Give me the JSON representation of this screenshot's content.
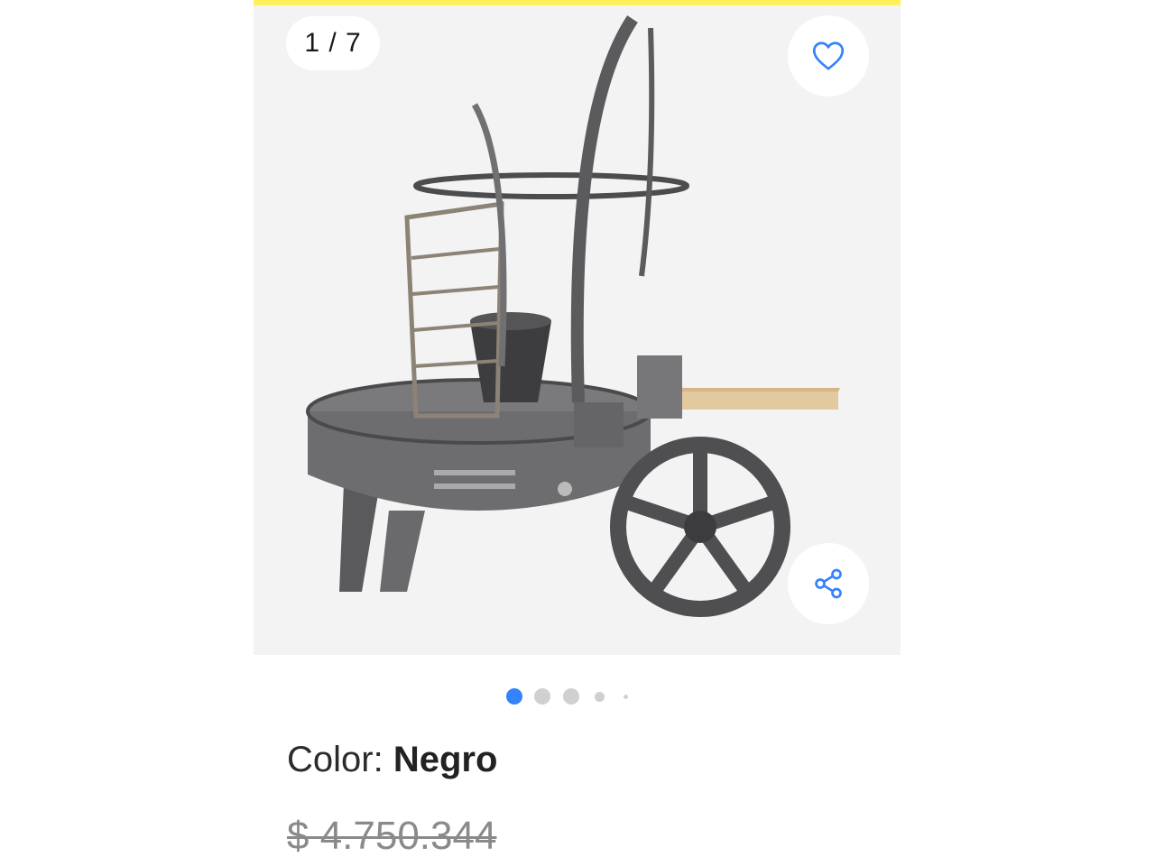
{
  "gallery": {
    "counter": "1 / 7",
    "current_image": 1,
    "total_images": 7,
    "favorite_icon": "heart-outline-icon",
    "share_icon": "share-icon",
    "pagination_dots_visible": 5,
    "active_dot_index": 0
  },
  "product": {
    "color_label": "Color: ",
    "color_value": "Negro",
    "old_price": "$ 4.750.344"
  },
  "colors": {
    "top_bar": "#fff159",
    "accent": "#3483fa",
    "gallery_bg": "#f3f3f3",
    "dot_inactive": "#d0d0d0"
  }
}
